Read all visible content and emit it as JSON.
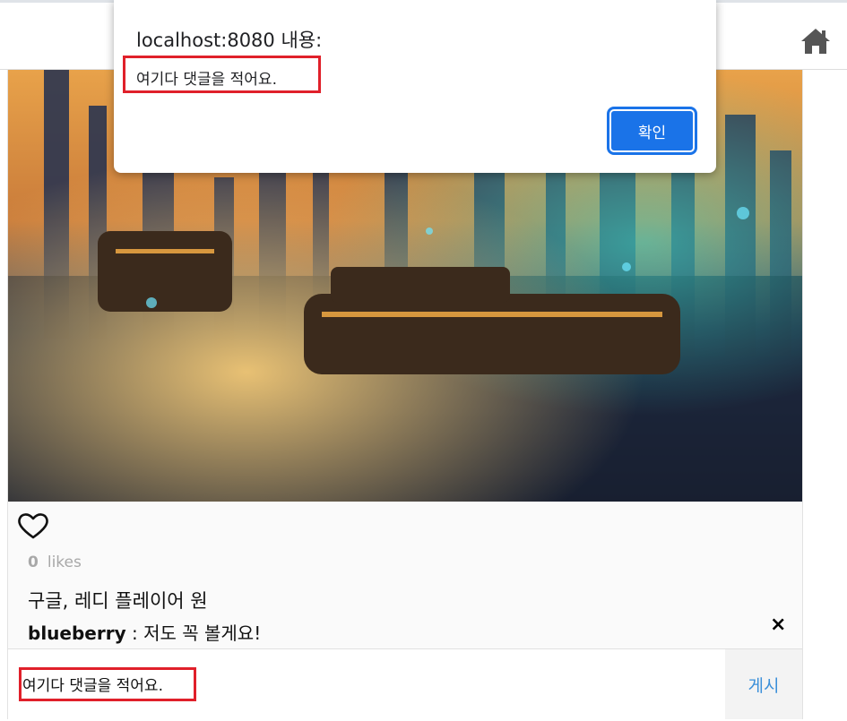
{
  "alert": {
    "title": "localhost:8080 내용:",
    "message": "여기다 댓글을 적어요.",
    "ok_label": "확인"
  },
  "nav": {
    "home_icon": "home-icon"
  },
  "post": {
    "likes_count": "0",
    "likes_label": "likes",
    "caption": "구글, 레디 플레이어 원",
    "comment": {
      "user": "blueberry",
      "separator": " : ",
      "text": "저도 꼭 볼게요!"
    },
    "comment_input": {
      "value": "여기다 댓글을 적어요.",
      "placeholder": ""
    },
    "post_label": "게시",
    "delete_icon": "×"
  },
  "colors": {
    "accent": "#1a73e8",
    "link": "#3a8fd9",
    "highlight": "#e0202a"
  }
}
